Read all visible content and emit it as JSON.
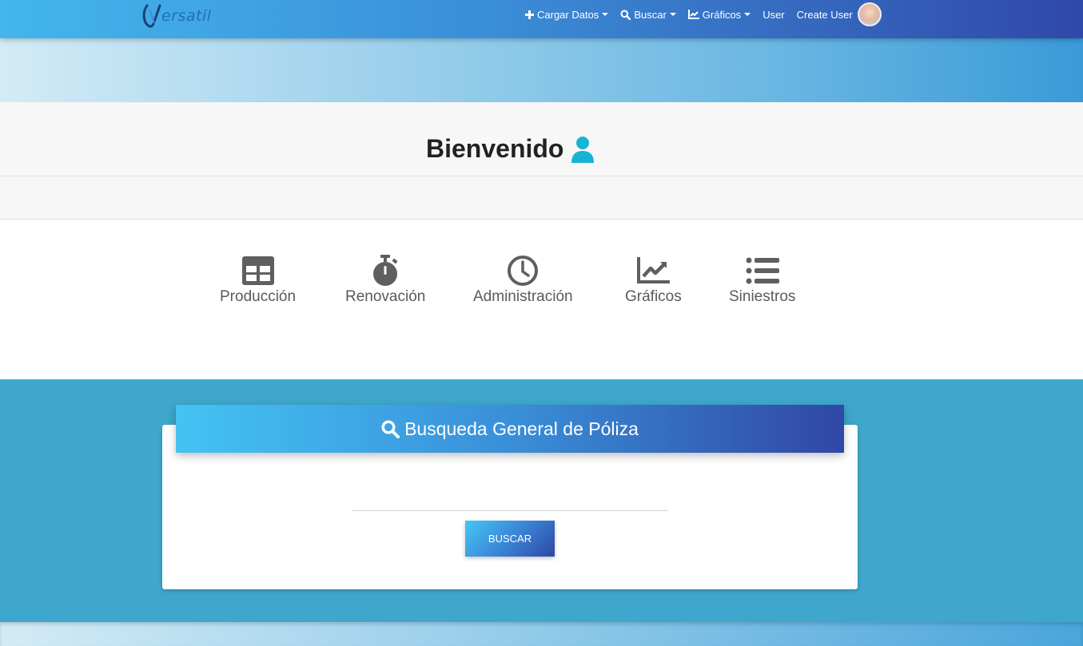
{
  "navbar": {
    "brand_text": "ersatil",
    "items": [
      {
        "label": "Cargar Datos",
        "icon": "plus-icon",
        "dropdown": true
      },
      {
        "label": "Buscar",
        "icon": "search-icon",
        "dropdown": true
      },
      {
        "label": "Gráficos",
        "icon": "chart-line-icon",
        "dropdown": true
      },
      {
        "label": "User",
        "dropdown": false
      },
      {
        "label": "Create User",
        "dropdown": false
      }
    ]
  },
  "welcome": {
    "title": "Bienvenido",
    "icon": "user-icon"
  },
  "shortcuts": [
    {
      "label": "Producción",
      "icon": "table-icon"
    },
    {
      "label": "Renovación",
      "icon": "stopwatch-icon"
    },
    {
      "label": "Administración",
      "icon": "clock-icon"
    },
    {
      "label": "Gráficos",
      "icon": "chart-line-icon"
    },
    {
      "label": "Siniestros",
      "icon": "list-icon"
    }
  ],
  "search_card": {
    "title": "Busqueda General de Póliza",
    "input_value": "",
    "button_label": "BUSCAR"
  },
  "colors": {
    "navbar_gradient": [
      "#43b6ec",
      "#3048a8"
    ],
    "section_bg": "#3ea7cb",
    "accent_icon": "#17b3d3"
  }
}
